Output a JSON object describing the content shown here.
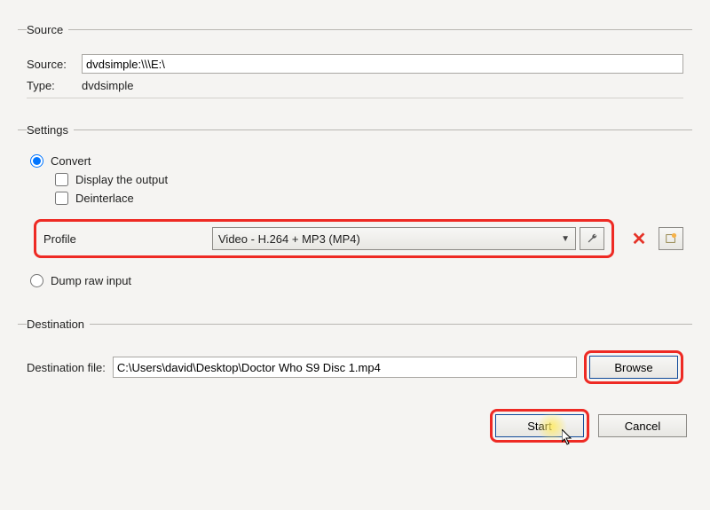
{
  "source_group": {
    "legend": "Source",
    "source_label": "Source:",
    "source_value": "dvdsimple:\\\\\\E:\\",
    "type_label": "Type:",
    "type_value": "dvdsimple"
  },
  "settings_group": {
    "legend": "Settings",
    "convert_label": "Convert",
    "display_output_label": "Display the output",
    "deinterlace_label": "Deinterlace",
    "profile_label": "Profile",
    "profile_selected": "Video - H.264 + MP3 (MP4)",
    "dump_raw_label": "Dump raw input"
  },
  "destination_group": {
    "legend": "Destination",
    "dest_label": "Destination file:",
    "dest_value": "C:\\Users\\david\\Desktop\\Doctor Who S9 Disc 1.mp4",
    "browse_label": "Browse"
  },
  "buttons": {
    "start": "Start",
    "cancel": "Cancel"
  }
}
